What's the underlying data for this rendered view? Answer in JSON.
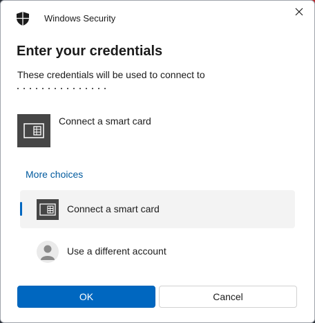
{
  "window": {
    "title": "Windows Security",
    "close_label": "×"
  },
  "dialog": {
    "heading": "Enter your credentials",
    "description": "These credentials will be used to connect to",
    "primary_option": {
      "label": "Connect a smart card",
      "icon": "smart-card-icon"
    },
    "more_choices_label": "More choices",
    "choices": [
      {
        "label": "Connect a smart card",
        "icon": "smart-card-icon",
        "selected": true
      },
      {
        "label": "Use a different account",
        "icon": "user-avatar-icon",
        "selected": false
      }
    ]
  },
  "buttons": {
    "ok_label": "OK",
    "cancel_label": "Cancel"
  },
  "colors": {
    "accent": "#0067c0",
    "link": "#005a9e",
    "icon_tile": "#464646",
    "selected_row": "#f3f3f3"
  }
}
